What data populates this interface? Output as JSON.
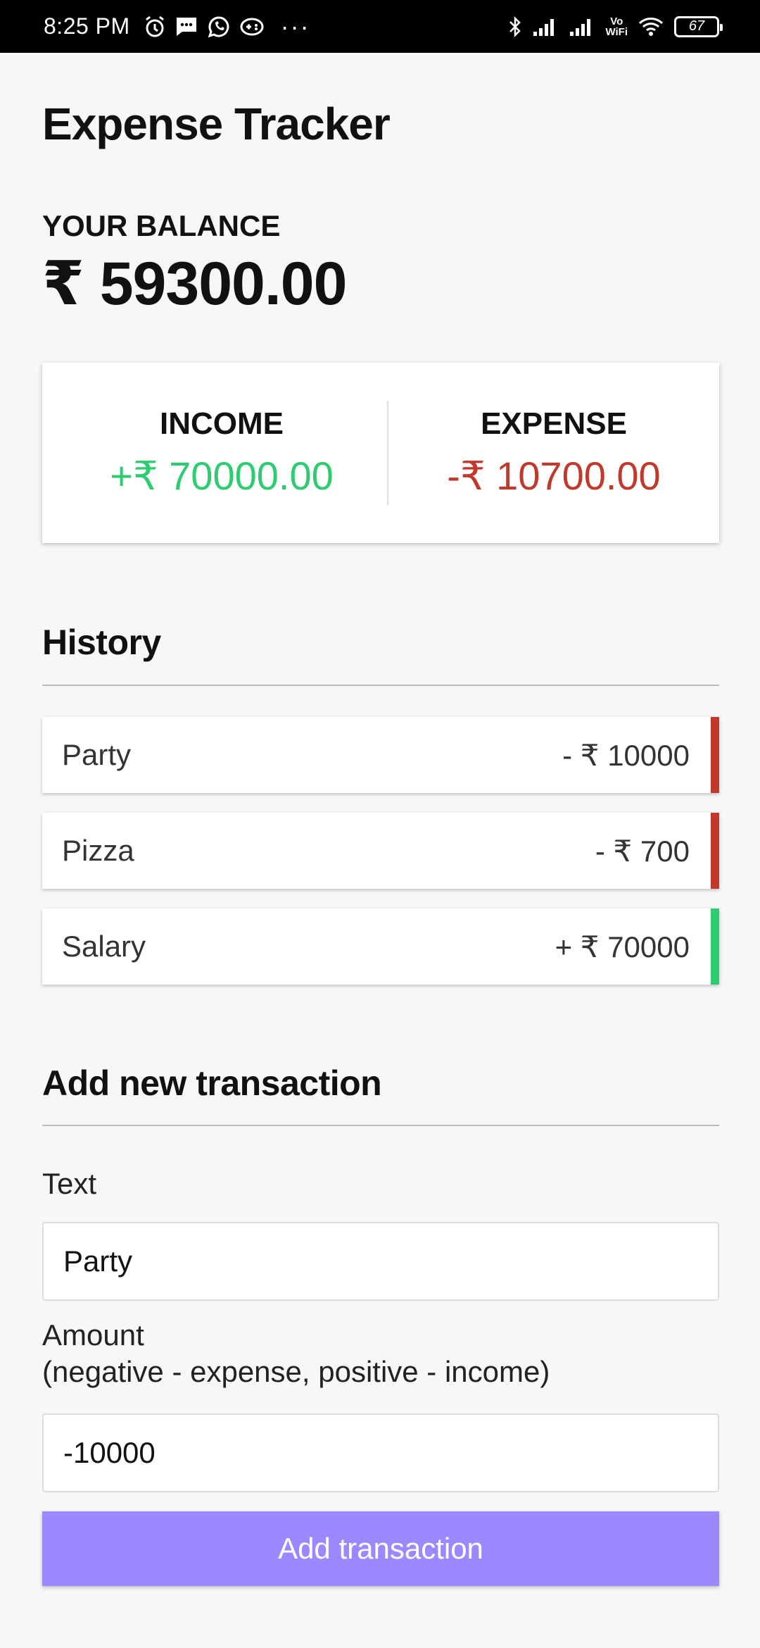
{
  "status_bar": {
    "time": "8:25 PM",
    "icons": [
      "alarm-icon",
      "message-icon",
      "whatsapp-icon",
      "game-icon",
      "more-dots-icon",
      "bluetooth-icon",
      "signal-icon",
      "signal-icon",
      "vowifi-icon",
      "wifi-icon",
      "battery-icon"
    ],
    "more": "···",
    "vowifi_top": "Vo",
    "vowifi_bottom": "WiFi",
    "battery": "67"
  },
  "app": {
    "title": "Expense Tracker",
    "balance_label": "YOUR BALANCE",
    "balance_value": "₹ 59300.00"
  },
  "summary": {
    "income_label": "INCOME",
    "income_value": "+₹ 70000.00",
    "expense_label": "EXPENSE",
    "expense_value": "-₹ 10700.00",
    "colors": {
      "income": "#2ecc71",
      "expense": "#c0392b"
    }
  },
  "history": {
    "title": "History",
    "items": [
      {
        "text": "Party",
        "amount": "- ₹ 10000",
        "type": "minus"
      },
      {
        "text": "Pizza",
        "amount": "- ₹ 700",
        "type": "minus"
      },
      {
        "text": "Salary",
        "amount": "+ ₹ 70000",
        "type": "plus"
      }
    ]
  },
  "form": {
    "title": "Add new transaction",
    "text_label": "Text",
    "text_value": "Party",
    "amount_label": "Amount",
    "amount_hint": "(negative - expense, positive - income)",
    "amount_value": "-10000",
    "submit_label": "Add transaction",
    "button_color": "#9c88ff"
  }
}
